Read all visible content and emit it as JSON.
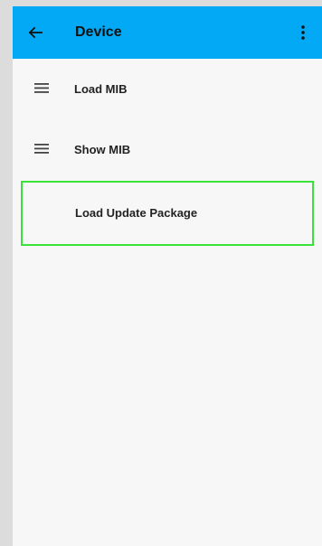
{
  "appbar": {
    "title": "Device",
    "back_icon": "arrow-left-icon",
    "more_icon": "more-vert-icon",
    "background": "#03a9f4"
  },
  "menu": {
    "items": [
      {
        "label": "Load MIB",
        "icon": "menu-icon"
      },
      {
        "label": "Show MIB",
        "icon": "menu-icon"
      },
      {
        "label": "Load Update Package",
        "icon": "",
        "highlight_color": "#39e33a"
      }
    ]
  }
}
